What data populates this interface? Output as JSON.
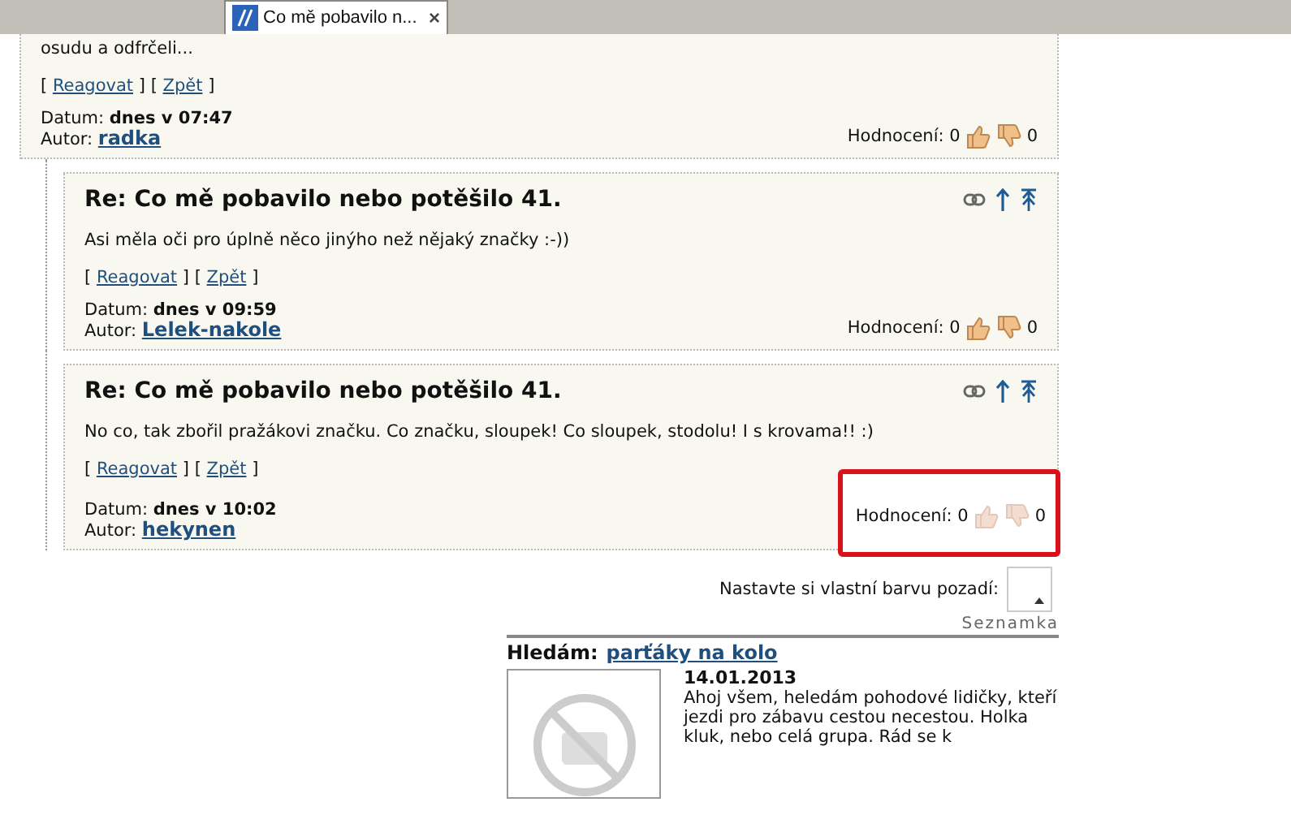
{
  "browser_tab": {
    "title": "Co mě pobavilo n...",
    "close": "×"
  },
  "posts": [
    {
      "body": "osudu a odfrčeli...",
      "links": [
        {
          "open": "[",
          "label": "Reagovat",
          "close": "]"
        },
        {
          "open": "[",
          "label": "Zpět",
          "close": "]"
        }
      ],
      "date_label": "Datum:",
      "date": "dnes v 07:47",
      "author_label": "Autor:",
      "author": "radka",
      "rating_label": "Hodnocení:",
      "likes": "0",
      "dislikes": "0",
      "rating_enabled": true,
      "highlighted": false,
      "reply": false,
      "icons": false
    },
    {
      "title": "Re: Co mě pobavilo nebo potěšilo 41.",
      "body": "Asi měla oči pro úplně něco jinýho než nějaký značky :-))",
      "links": [
        {
          "open": "[",
          "label": "Reagovat",
          "close": "]"
        },
        {
          "open": "[",
          "label": "Zpět",
          "close": "]"
        }
      ],
      "date_label": "Datum:",
      "date": "dnes v 09:59",
      "author_label": "Autor:",
      "author": "Lelek-nakole",
      "rating_label": "Hodnocení:",
      "likes": "0",
      "dislikes": "0",
      "rating_enabled": true,
      "highlighted": false,
      "reply": true,
      "icons": true
    },
    {
      "title": "Re: Co mě pobavilo nebo potěšilo 41.",
      "body": "No co, tak zbořil pražákovi značku. Co značku, sloupek! Co sloupek, stodolu! I s krovama!! :)",
      "links": [
        {
          "open": "[",
          "label": "Reagovat",
          "close": "]"
        },
        {
          "open": "[",
          "label": "Zpět",
          "close": "]"
        }
      ],
      "date_label": "Datum:",
      "date": "dnes v 10:02",
      "author_label": "Autor:",
      "author": "hekynen",
      "rating_label": "Hodnocení:",
      "likes": "0",
      "dislikes": "0",
      "rating_enabled": false,
      "highlighted": true,
      "reply": true,
      "icons": true
    }
  ],
  "background_color": {
    "label": "Nastavte si vlastní barvu pozadí:"
  },
  "dating": {
    "section": "Seznamka",
    "heading": "Hledám:",
    "link": "parťáky na kolo",
    "date": "14.01.2013",
    "text": "Ahoj všem, heledám pohodové lidičky, kteří jezdi pro zábavu cestou necestou. Holka kluk, nebo celá grupa. Rád se k"
  }
}
